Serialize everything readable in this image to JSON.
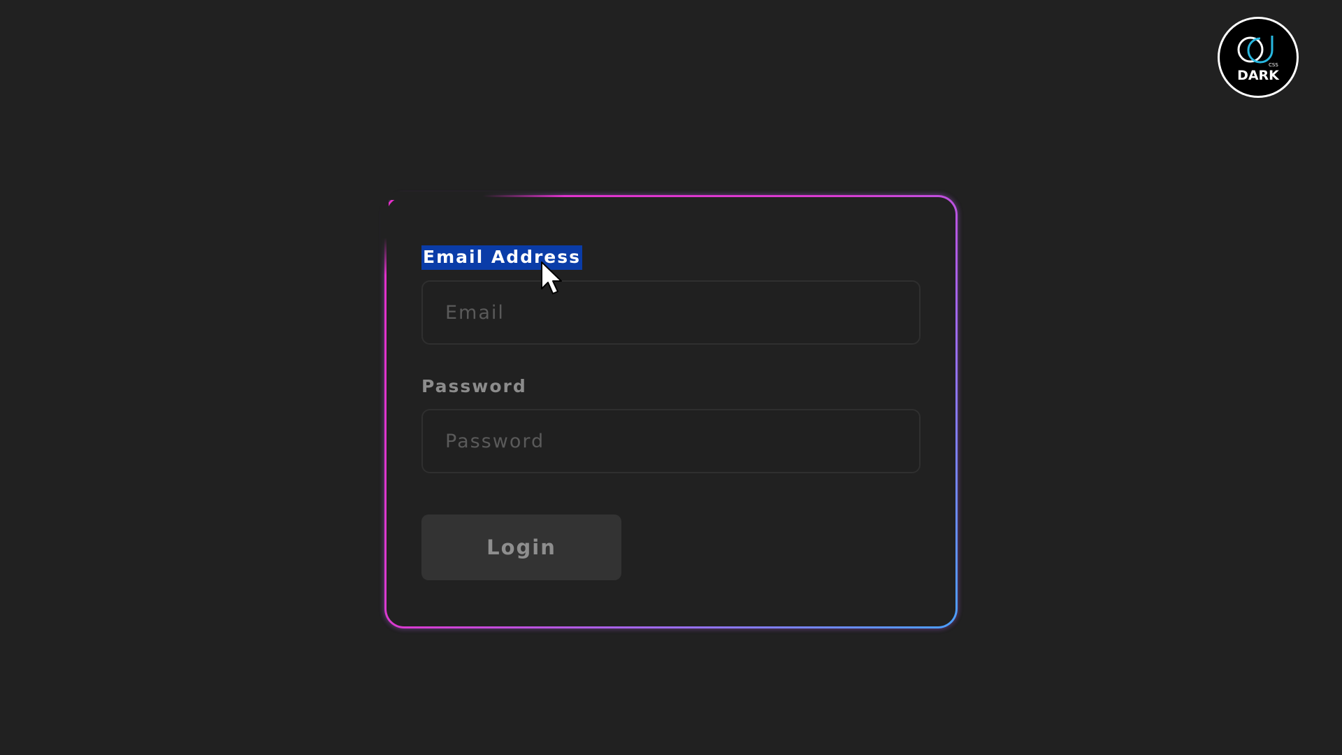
{
  "logo": {
    "text": "DARK",
    "icon": "css-dark-logo-icon"
  },
  "form": {
    "email_label": "Email Address",
    "email_placeholder": "Email",
    "email_value": "",
    "password_label": "Password",
    "password_placeholder": "Password",
    "password_value": "",
    "login_label": "Login"
  },
  "colors": {
    "background": "#212121",
    "border_gradient_start": "#e52ec9",
    "border_gradient_end": "#4aa0ff",
    "selection": "#0a3ca8"
  }
}
